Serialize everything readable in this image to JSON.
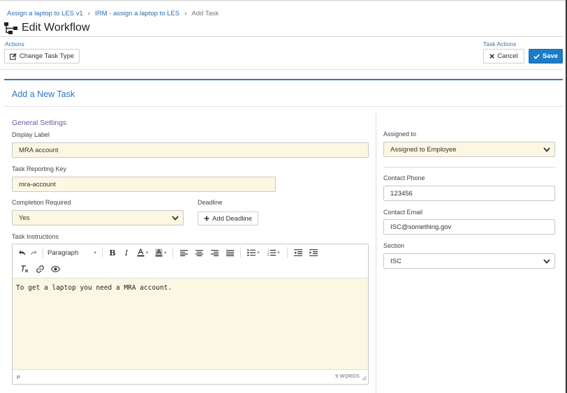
{
  "breadcrumb": {
    "items": [
      "Assign a laptop to LES v1",
      "IRM - assign a laptop to LES"
    ],
    "separator": "›",
    "current": "Add Task"
  },
  "page": {
    "title": "Edit Workflow",
    "title_icon": "workflow-icon"
  },
  "actions": {
    "label": "Actions",
    "change_task_type": "Change Task Type"
  },
  "task_actions": {
    "label": "Task Actions",
    "cancel": "Cancel",
    "save": "Save"
  },
  "card": {
    "title": "Add a New Task"
  },
  "general": {
    "section_title": "General Settings",
    "display_label": {
      "label": "Display Label",
      "value": "MRA account"
    },
    "reporting_key": {
      "label": "Task Reporting Key",
      "value": "mra-account"
    },
    "completion_required": {
      "label": "Completion Required",
      "value": "Yes"
    },
    "deadline": {
      "label": "Deadline",
      "button": "Add Deadline"
    },
    "instructions": {
      "label": "Task Instructions",
      "format_value": "Paragraph",
      "body": "To get a laptop you need a MRA account.",
      "status_path": "P",
      "word_count": "9 WORDS"
    }
  },
  "assignment": {
    "assigned_to": {
      "label": "Assigned to",
      "value": "Assigned to Employee"
    },
    "contact_phone": {
      "label": "Contact Phone",
      "value": "123456"
    },
    "contact_email": {
      "label": "Contact Email",
      "value": "ISC@something.gov"
    },
    "section": {
      "label": "Section",
      "value": "ISC"
    }
  },
  "colors": {
    "accent": "#2f78be",
    "save_bg": "#1e7bc6",
    "section_title": "#6e57a8",
    "field_bg": "#fcf7e3"
  }
}
